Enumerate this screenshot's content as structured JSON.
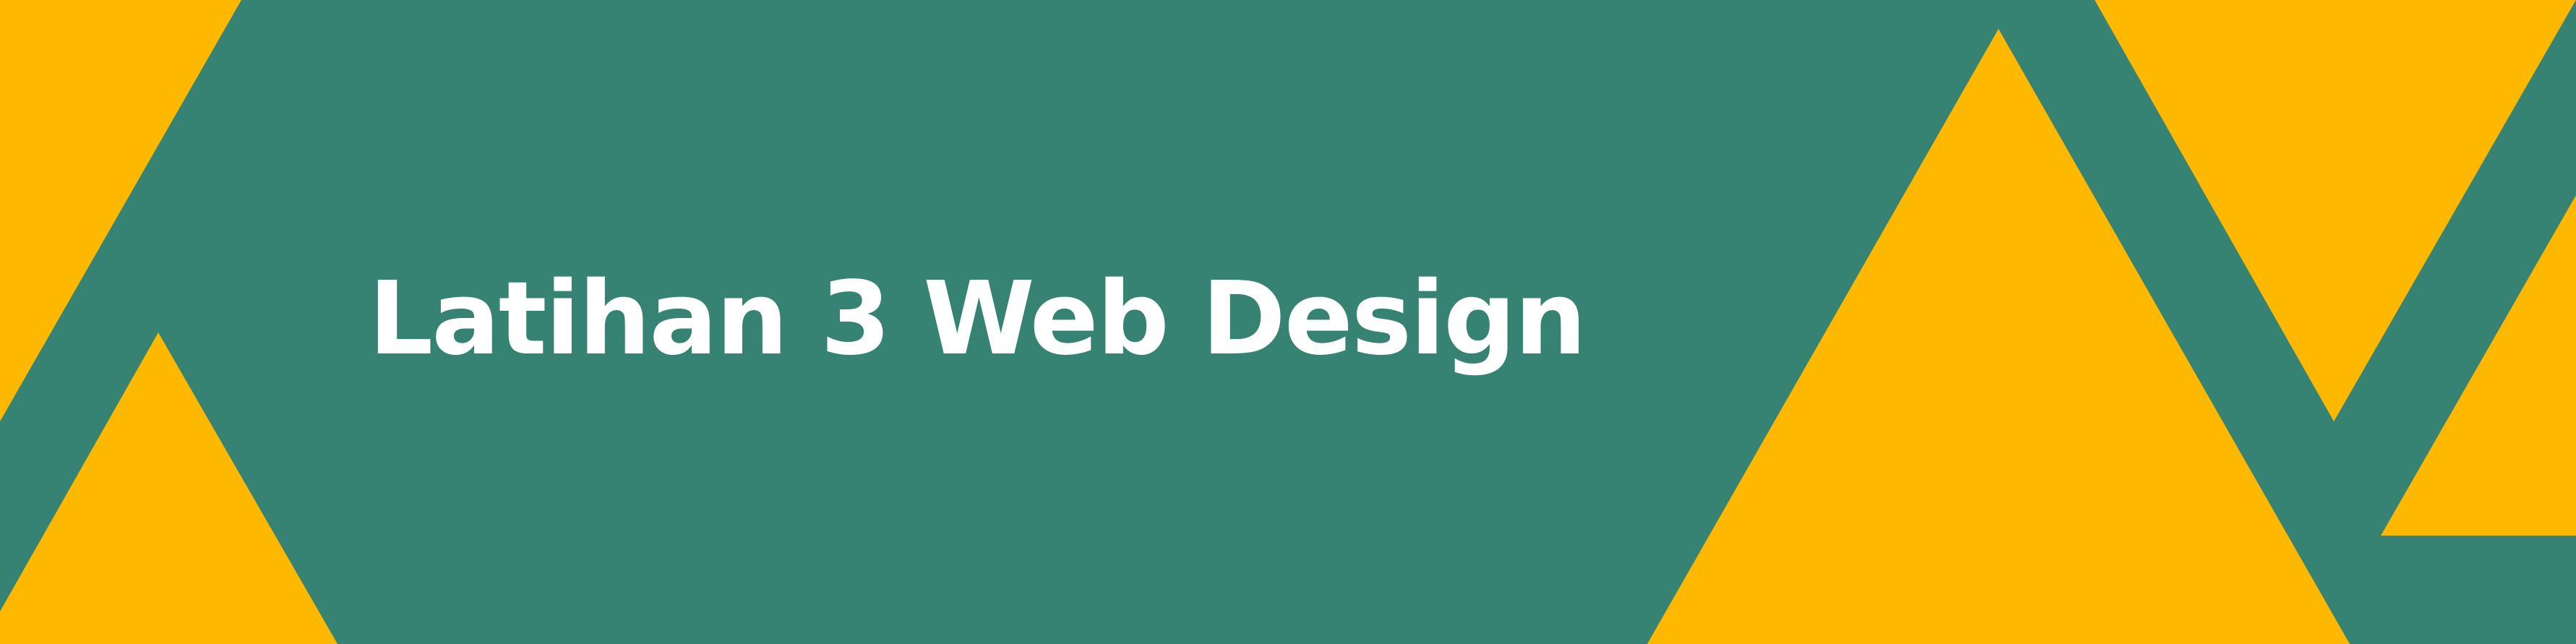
{
  "banner": {
    "title": "Latihan 3 Web Design"
  },
  "colors": {
    "background": "#368273",
    "accent": "#FFB800",
    "text": "#FFFFFF"
  }
}
